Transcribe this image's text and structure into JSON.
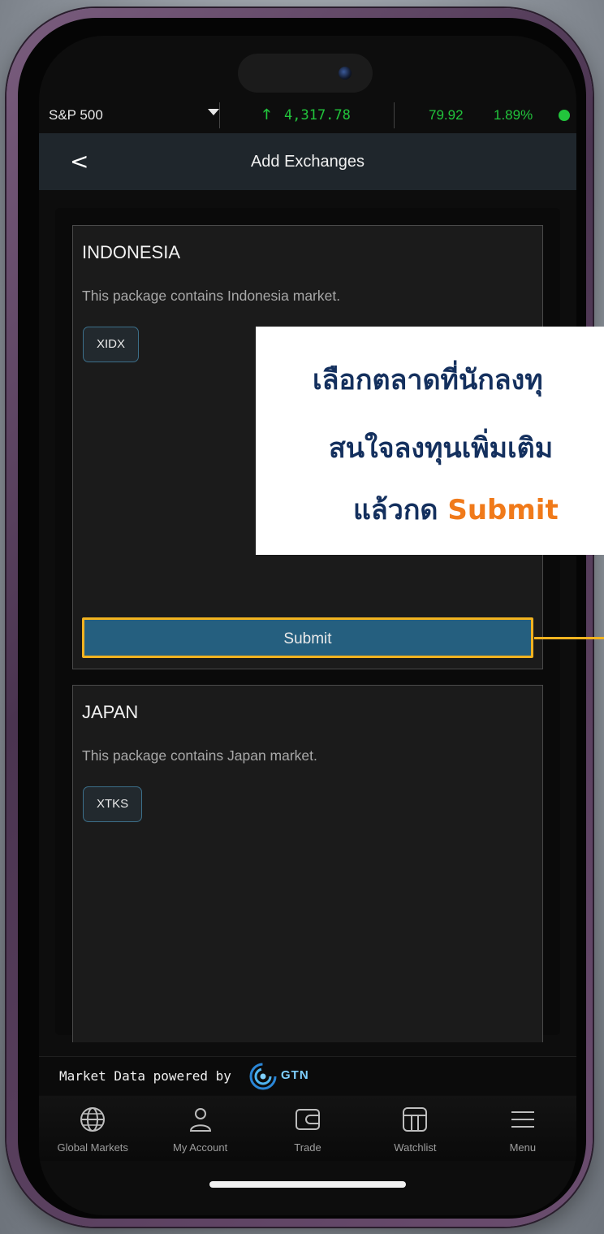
{
  "ticker": {
    "index_name": "S&P 500",
    "direction_arrow": "🡑",
    "price": "4,317.78",
    "change": "79.92",
    "change_pct": "1.89%",
    "status_color": "#22c53c"
  },
  "header": {
    "back_label": "<",
    "title": "Add Exchanges"
  },
  "packages": [
    {
      "name": "INDONESIA",
      "description": "This package contains Indonesia market.",
      "exchanges": [
        "XIDX"
      ],
      "submit_label": "Submit"
    },
    {
      "name": "JAPAN",
      "description": "This package contains Japan market.",
      "exchanges": [
        "XTKS"
      ]
    }
  ],
  "footer": {
    "powered_text": "Market Data powered by",
    "brand": "GTN"
  },
  "tabs": [
    {
      "label": "Global Markets",
      "icon": "globe-icon"
    },
    {
      "label": "My Account",
      "icon": "user-icon"
    },
    {
      "label": "Trade",
      "icon": "wallet-icon"
    },
    {
      "label": "Watchlist",
      "icon": "watchlist-icon"
    },
    {
      "label": "Menu",
      "icon": "menu-icon"
    }
  ],
  "callout": {
    "line1": "เลือกตลาดที่นักลงทุ",
    "line2": "สนใจลงทุนเพิ่มเติม",
    "line3_prefix": "แล้วกด ",
    "line3_accent": "Submit",
    "accent_color": "#f07a1a",
    "highlight_color": "#f2b320"
  }
}
